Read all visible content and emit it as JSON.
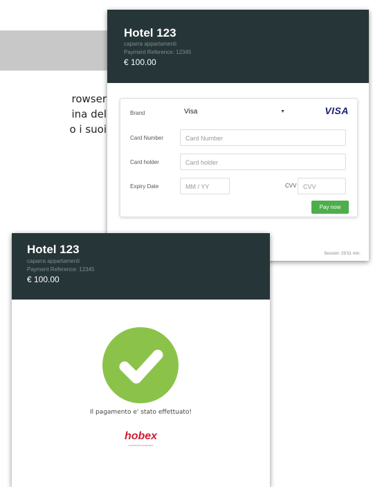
{
  "background": {
    "lines": [
      "rowser",
      "ina del",
      "o i suoi"
    ]
  },
  "payment_form": {
    "hotel_name": "Hotel 123",
    "description": "caparra appartamenti",
    "payment_reference": "Payment Reference: 12345",
    "amount": "€ 100.00",
    "brand_label": "Brand",
    "brand_value": "Visa",
    "brand_logo": "VISA",
    "card_number_label": "Card Number",
    "card_number_placeholder": "Card Number",
    "card_holder_label": "Card holder",
    "card_holder_placeholder": "Card holder",
    "expiry_label": "Expiry Date",
    "expiry_placeholder": "MM / YY",
    "cvv_label": "CVV",
    "cvv_placeholder": "CVV",
    "pay_button": "Pay now",
    "session": "Session: 29:51 min."
  },
  "success": {
    "hotel_name": "Hotel 123",
    "description": "caparra appartamenti",
    "payment_reference": "Payment Reference: 12345",
    "amount": "€ 100.00",
    "message": "Il pagamento e' stato effettuato!",
    "logo": "hobex",
    "logo_tagline": "convenient payment"
  },
  "colors": {
    "header_bg": "#263638",
    "pay_button": "#4cae4c",
    "success_circle": "#8bc34a",
    "logo_red": "#cc1f36"
  }
}
